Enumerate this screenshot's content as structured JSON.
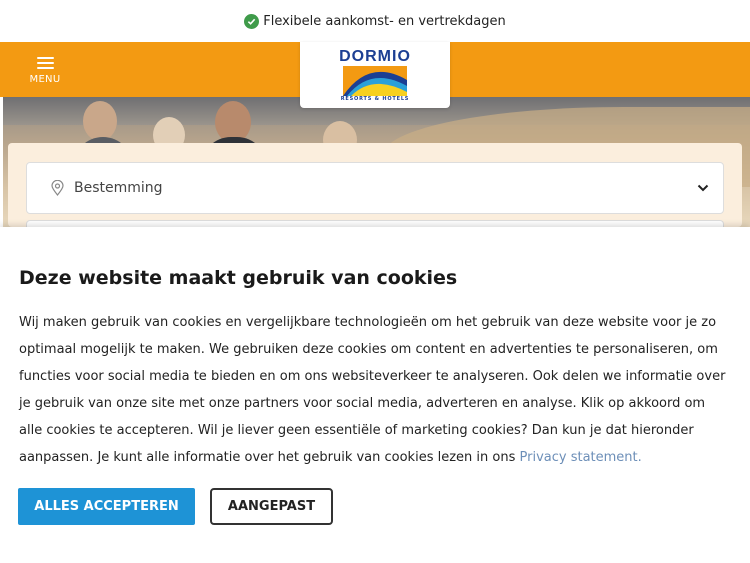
{
  "topbar": {
    "message": "Flexibele aankomst- en vertrekdagen",
    "icon": "check-circle-icon",
    "icon_color": "#3f9b4a"
  },
  "nav": {
    "menu_label": "MENU",
    "accent_color": "#f39a12"
  },
  "logo": {
    "name": "DORMIO",
    "tagline": "RESORTS & HOTELS"
  },
  "search": {
    "destination_label": "Bestemming"
  },
  "cookie": {
    "title": "Deze website maakt gebruik van cookies",
    "body": "Wij maken gebruik van cookies en vergelijkbare technologieën om het gebruik van deze website voor je zo optimaal mogelijk te maken. We gebruiken deze cookies om content en advertenties te personaliseren, om functies voor social media te bieden en om ons websiteverkeer te analyseren. Ook delen we informatie over je gebruik van onze site met onze partners voor social media, adverteren en analyse. Klik op akkoord om alle cookies te accepteren. Wil je liever geen essentiële of marketing cookies? Dan kun je dat hieronder aanpassen. Je kunt alle informatie over het gebruik van cookies lezen in ons",
    "privacy_link": "Privacy statement.",
    "accept_label": "ALLES ACCEPTEREN",
    "custom_label": "AANGEPAST",
    "accept_color": "#1e93d6"
  }
}
